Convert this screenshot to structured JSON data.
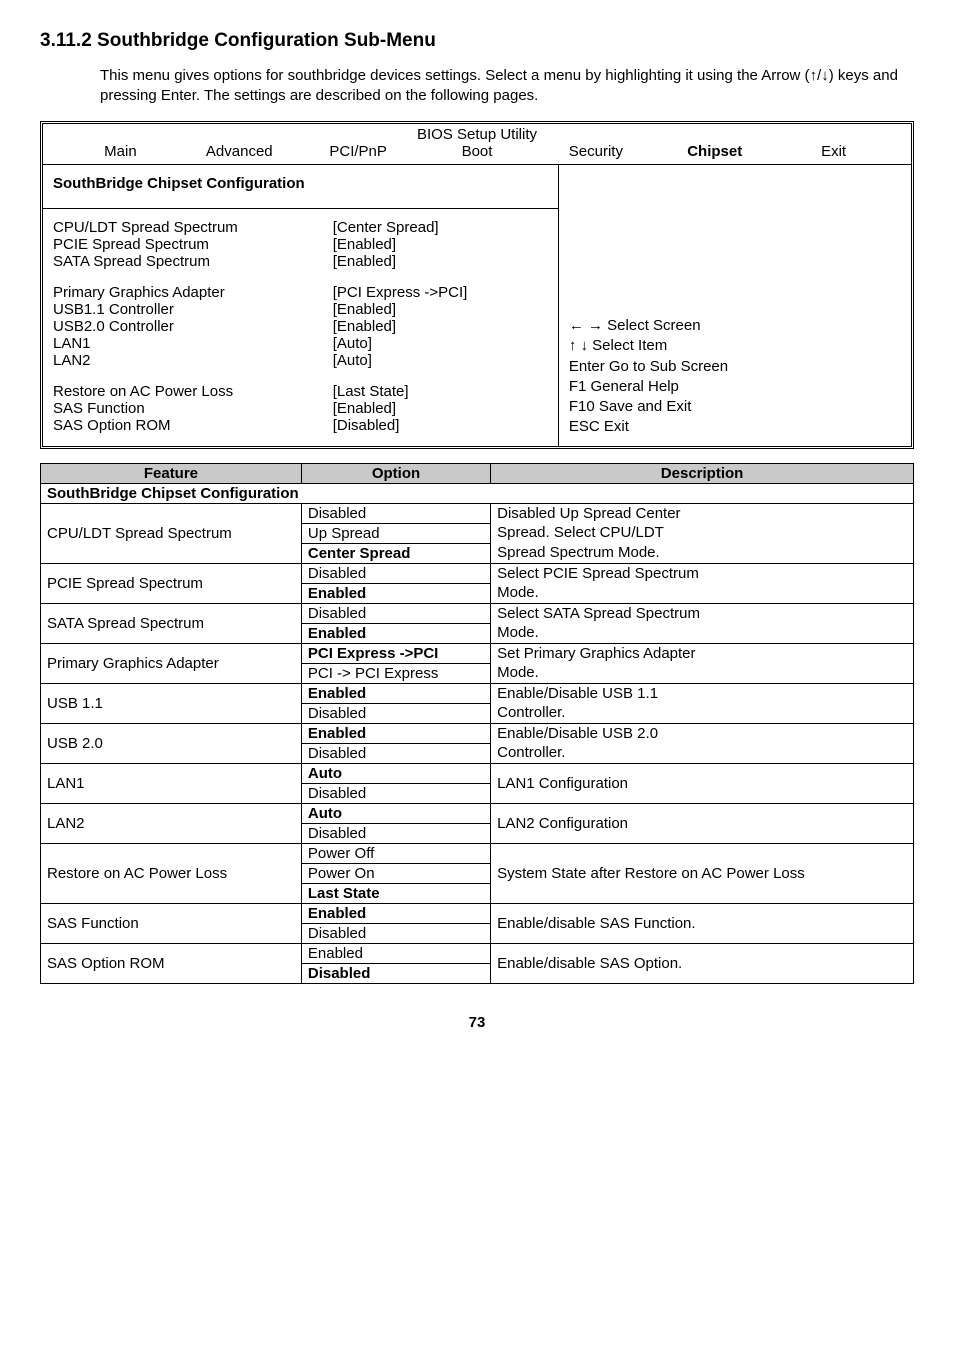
{
  "heading": "3.11.2   Southbridge Configuration Sub-Menu",
  "intro": "This menu gives options for southbridge devices settings. Select a menu by highlighting it using the Arrow (↑/↓) keys and pressing Enter.  The settings are described on the following pages.",
  "bios": {
    "title": "BIOS Setup Utility",
    "tabs": [
      "Main",
      "Advanced",
      "PCI/PnP",
      "Boot",
      "Security",
      "Chipset",
      "Exit"
    ],
    "section_title": "SouthBridge Chipset Configuration",
    "rows_group1": [
      {
        "label": "CPU/LDT Spread Spectrum",
        "value": "[Center Spread]"
      },
      {
        "label": "PCIE Spread Spectrum",
        "value": "[Enabled]"
      },
      {
        "label": "SATA Spread Spectrum",
        "value": "[Enabled]"
      }
    ],
    "rows_group2": [
      {
        "label": "Primary Graphics Adapter",
        "value": "[PCI Express ->PCI]"
      },
      {
        "label": "USB1.1 Controller",
        "value": "[Enabled]"
      },
      {
        "label": "USB2.0 Controller",
        "value": "[Enabled]"
      },
      {
        "label": "LAN1",
        "value": "[Auto]"
      },
      {
        "label": "LAN2",
        "value": "[Auto]"
      }
    ],
    "rows_group3": [
      {
        "label": "Restore on AC Power Loss",
        "value": "[Last State]"
      },
      {
        "label": "SAS Function",
        "value": "[Enabled]"
      },
      {
        "label": "SAS Option ROM",
        "value": "[Disabled]"
      }
    ],
    "help": [
      "← → Select Screen",
      "↑  ↓  Select Item",
      "Enter Go to Sub Screen",
      "F1     General Help",
      "F10   Save and Exit",
      "ESC  Exit"
    ]
  },
  "table": {
    "headers": [
      "Feature",
      "Option",
      "Description"
    ],
    "section": "SouthBridge Chipset Configuration",
    "rows": [
      {
        "feature": "CPU/LDT Spread Spectrum",
        "options": [
          "Disabled",
          "Up Spread",
          "Center Spread"
        ],
        "bold": [
          false,
          false,
          true
        ],
        "desc": [
          "Disabled Up Spread Center",
          "Spread. Select CPU/LDT",
          "Spread Spectrum Mode."
        ]
      },
      {
        "feature": "PCIE Spread Spectrum",
        "options": [
          "Disabled",
          "Enabled"
        ],
        "bold": [
          false,
          true
        ],
        "desc": [
          "Select PCIE Spread Spectrum",
          "Mode."
        ]
      },
      {
        "feature": "SATA Spread Spectrum",
        "options": [
          "Disabled",
          "Enabled"
        ],
        "bold": [
          false,
          true
        ],
        "desc": [
          "Select SATA Spread Spectrum",
          "Mode."
        ]
      },
      {
        "feature": "Primary Graphics Adapter",
        "options": [
          "PCI Express ->PCI",
          "PCI -> PCI Express"
        ],
        "bold": [
          true,
          false
        ],
        "desc": [
          "Set Primary Graphics Adapter",
          "Mode."
        ]
      },
      {
        "feature": "USB 1.1",
        "options": [
          "Enabled",
          "Disabled"
        ],
        "bold": [
          true,
          false
        ],
        "desc": [
          "Enable/Disable USB 1.1",
          "Controller."
        ]
      },
      {
        "feature": "USB 2.0",
        "options": [
          "Enabled",
          "Disabled"
        ],
        "bold": [
          true,
          false
        ],
        "desc": [
          "Enable/Disable USB 2.0",
          "Controller."
        ]
      },
      {
        "feature": "LAN1",
        "options": [
          "Auto",
          "Disabled"
        ],
        "bold": [
          true,
          false
        ],
        "desc_single": "LAN1 Configuration"
      },
      {
        "feature": "LAN2",
        "options": [
          "Auto",
          "Disabled"
        ],
        "bold": [
          true,
          false
        ],
        "desc_single": "LAN2 Configuration"
      },
      {
        "feature": "Restore on AC Power Loss",
        "options": [
          "Power Off",
          "Power On",
          "Last State"
        ],
        "bold": [
          false,
          false,
          true
        ],
        "desc_single": "System State after Restore on AC Power Loss"
      },
      {
        "feature": "SAS Function",
        "options": [
          "Enabled",
          "Disabled"
        ],
        "bold": [
          true,
          false
        ],
        "desc_single": "Enable/disable SAS Function."
      },
      {
        "feature": "SAS Option ROM",
        "options": [
          "Enabled",
          "Disabled"
        ],
        "bold": [
          false,
          true
        ],
        "desc_single": "Enable/disable SAS Option."
      }
    ]
  },
  "page_number": "73"
}
